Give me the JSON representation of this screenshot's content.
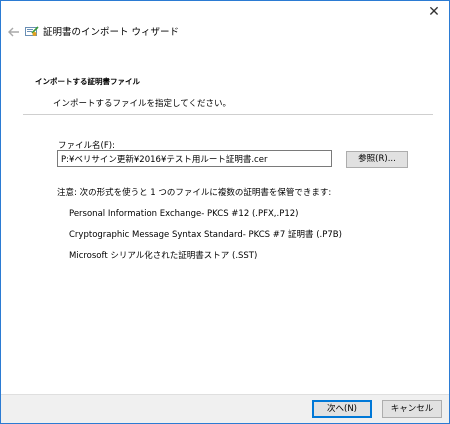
{
  "window": {
    "title": "証明書のインポート ウィザード",
    "close_glyph": "✕",
    "accent_color": "#0078d7"
  },
  "section": {
    "heading": "インポートする証明書ファイル",
    "description": "インポートするファイルを指定してください。"
  },
  "file_field": {
    "label": "ファイル名(F):",
    "value": "P:¥ベリサイン更新¥2016¥テスト用ルート証明書.cer"
  },
  "browse_button": {
    "label": "参照(R)..."
  },
  "note": "注意: 次の形式を使うと 1 つのファイルに複数の証明書を保管できます:",
  "formats": [
    "Personal Information Exchange- PKCS #12 (.PFX,.P12)",
    "Cryptographic Message Syntax Standard- PKCS #7 証明書 (.P7B)",
    "Microsoft シリアル化された証明書ストア (.SST)"
  ],
  "footer": {
    "next_label": "次へ(N)",
    "cancel_label": "キャンセル"
  },
  "icons": {
    "back": "back-arrow-icon",
    "wizard": "certificate-wizard-icon",
    "close": "close-icon"
  }
}
